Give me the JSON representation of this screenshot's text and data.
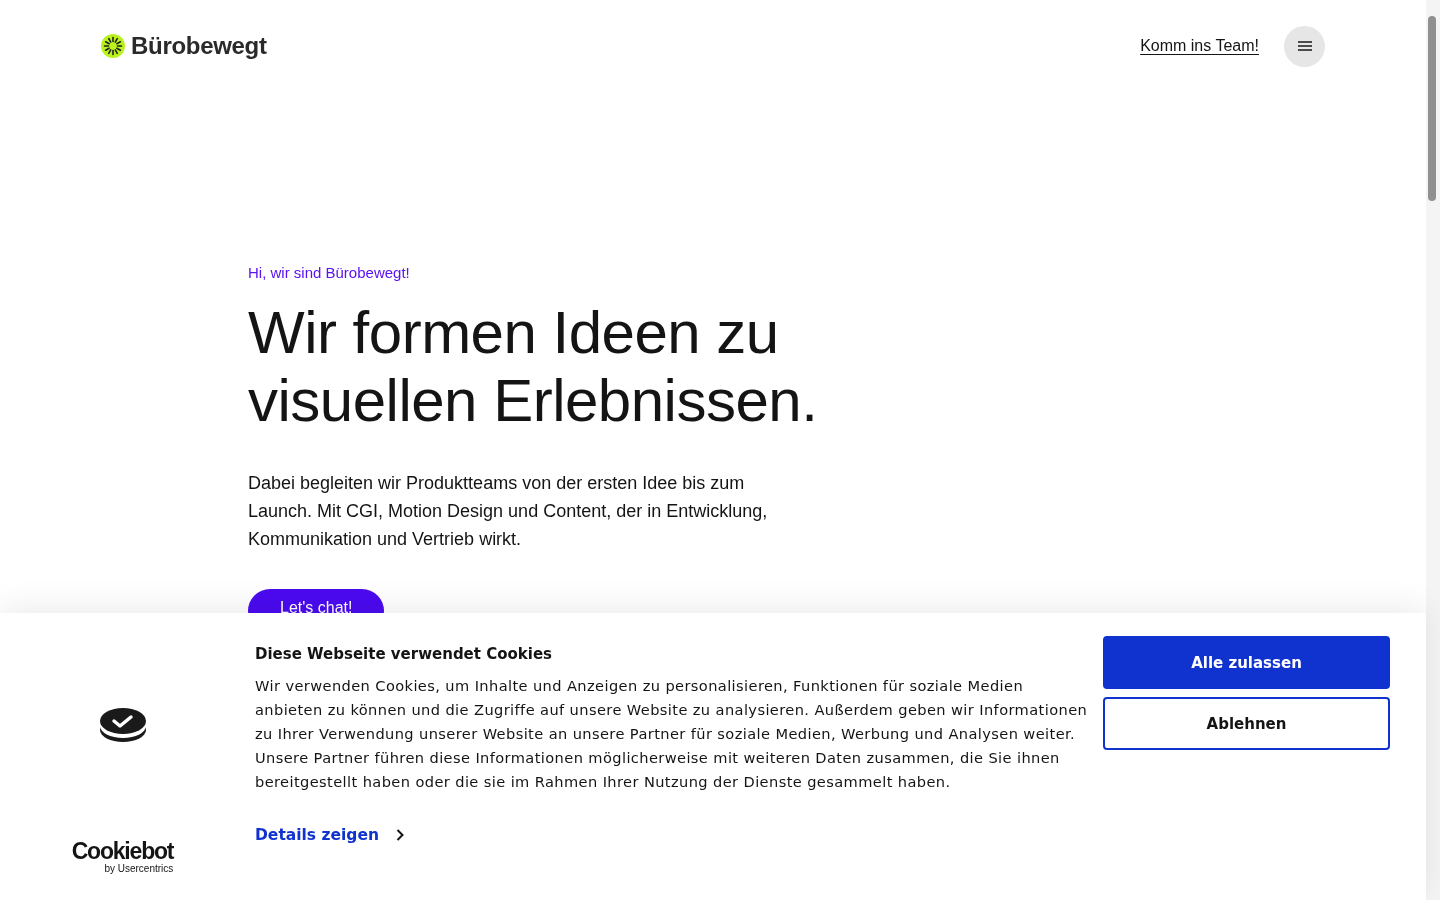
{
  "header": {
    "logo_text": "Bürobewegt",
    "nav_link": "Komm ins Team!"
  },
  "hero": {
    "eyebrow": "Hi, wir sind Bürobewegt!",
    "headline_lines": [
      "Wir formen Ideen zu",
      "visuellen Erlebnissen."
    ],
    "intro": "Dabei begleiten wir Produktteams von der ersten Idee bis zum Launch. Mit CGI, Motion Design und Content, der in Entwicklung, Kommunikation und Vertrieb wirkt.",
    "cta": "Let's chat!"
  },
  "cookie_banner": {
    "brand": "Cookiebot",
    "brand_sub": "by Usercentrics",
    "title": "Diese Webseite verwendet Cookies",
    "body": "Wir verwenden Cookies, um Inhalte und Anzeigen zu personalisieren, Funktionen für soziale Medien anbieten zu können und die Zugriffe auf unsere Website zu analysieren. Außerdem geben wir Informationen zu Ihrer Verwendung unserer Website an unsere Partner für soziale Medien, Werbung und Analysen weiter. Unsere Partner führen diese Informationen möglicherweise mit weiteren Daten zusammen, die Sie ihnen bereitgestellt haben oder die sie im Rahmen Ihrer Nutzung der Dienste gesammelt haben.",
    "details_link": "Details zeigen",
    "buttons": [
      {
        "label": "Alle zulassen",
        "kind": "primary"
      },
      {
        "label": "Ablehnen",
        "kind": "outline"
      }
    ]
  }
}
